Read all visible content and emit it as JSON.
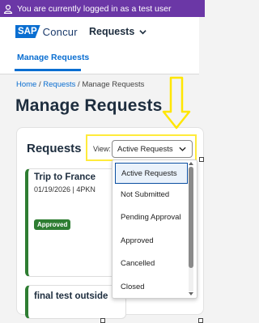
{
  "banner": {
    "text": "You are currently logged in as a test user",
    "icon": "user-icon"
  },
  "header": {
    "logo": {
      "sap": "SAP",
      "concur": "Concur"
    },
    "menu_label": "Requests",
    "subnav_label": "Manage Requests"
  },
  "breadcrumb": {
    "home": "Home",
    "sep1": "/",
    "requests": "Requests",
    "sep2": "/",
    "current": "Manage Requests"
  },
  "page_title": "Manage Requests",
  "panel": {
    "title": "Requests",
    "view_label": "View:",
    "select_value": "Active Requests"
  },
  "cards": [
    {
      "title": "Trip to France",
      "subtitle": "01/19/2026 | 4PKN",
      "status": "Approved"
    },
    {
      "title": "final test outside"
    }
  ],
  "dropdown": {
    "options": [
      "Active Requests",
      "Not Submitted",
      "Pending Approval",
      "Approved",
      "Cancelled",
      "Closed"
    ],
    "selected": "Active Requests"
  },
  "colors": {
    "banner": "#6b37a6",
    "accent": "#0a6ed1",
    "approved": "#2e7d32",
    "highlight": "#ffeb3b"
  }
}
